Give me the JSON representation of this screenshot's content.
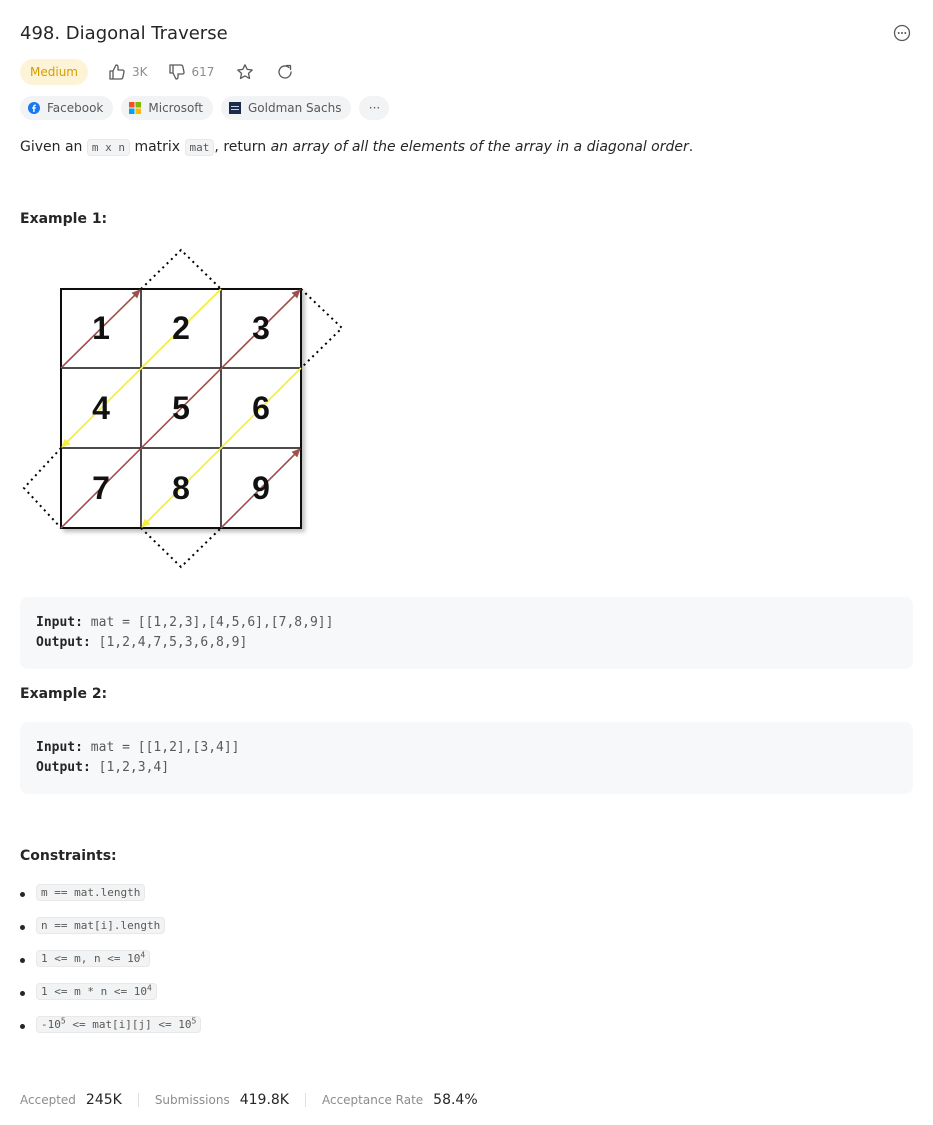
{
  "problem": {
    "title": "498. Diagonal Traverse",
    "difficulty": "Medium",
    "likes": "3K",
    "dislikes": "617"
  },
  "tags": [
    {
      "label": "Facebook",
      "color": "#1877f2"
    },
    {
      "label": "Microsoft",
      "color": "#f25022"
    },
    {
      "label": "Goldman Sachs",
      "color": "#1b2a4a"
    }
  ],
  "tags_more": "···",
  "description": {
    "p1": "Given an ",
    "code1": "m x n",
    "p2": " matrix ",
    "code2": "mat",
    "p3": ", return ",
    "em": "an array of all the elements of the array in a diagonal order",
    "p4": "."
  },
  "examples": [
    {
      "title": "Example 1:",
      "matrix": [
        "1",
        "2",
        "3",
        "4",
        "5",
        "6",
        "7",
        "8",
        "9"
      ],
      "input_label": "Input:",
      "input": "mat = [[1,2,3],[4,5,6],[7,8,9]]",
      "output_label": "Output:",
      "output": "[1,2,4,7,5,3,6,8,9]"
    },
    {
      "title": "Example 2:",
      "input_label": "Input:",
      "input": "mat = [[1,2],[3,4]]",
      "output_label": "Output:",
      "output": "[1,2,3,4]"
    }
  ],
  "constraints": {
    "title": "Constraints:",
    "items": [
      {
        "text": "m == mat.length"
      },
      {
        "text": "n == mat[i].length"
      },
      {
        "pre": "1 <= m, n <= 10",
        "sup": "4"
      },
      {
        "pre": "1 <= m * n <= 10",
        "sup": "4"
      },
      {
        "pre": "-10",
        "sup": "5",
        "mid": " <= mat[i][j] <= 10",
        "sup2": "5"
      }
    ]
  },
  "stats": {
    "accepted_label": "Accepted",
    "accepted": "245K",
    "submissions_label": "Submissions",
    "submissions": "419.8K",
    "rate_label": "Acceptance Rate",
    "rate": "58.4%"
  },
  "colors": {
    "difficulty_bg": "#fdf3d7",
    "difficulty_fg": "#d89b00",
    "arrow_up": "#a0504a",
    "arrow_down": "#f5ef40"
  }
}
